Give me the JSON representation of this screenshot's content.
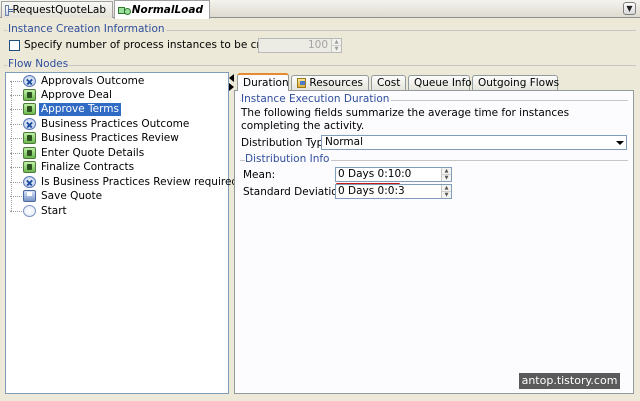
{
  "editor_tabs": [
    {
      "label": "RequestQuoteLab",
      "active": false
    },
    {
      "label": "NormalLoad",
      "active": true
    }
  ],
  "instance_creation": {
    "title": "Instance Creation Information",
    "checkbox_label": "Specify number of process instances to be created",
    "checked": false,
    "count_value": "100"
  },
  "flow_nodes": {
    "title": "Flow Nodes",
    "items": [
      {
        "label": "Approvals Outcome",
        "icon": "decision-icon",
        "selected": false
      },
      {
        "label": "Approve Deal",
        "icon": "activity-icon",
        "selected": false
      },
      {
        "label": "Approve Terms",
        "icon": "activity-icon",
        "selected": true
      },
      {
        "label": "Business Practices Outcome",
        "icon": "decision-icon",
        "selected": false
      },
      {
        "label": "Business Practices Review",
        "icon": "activity-icon",
        "selected": false
      },
      {
        "label": "Enter Quote Details",
        "icon": "activity-icon",
        "selected": false
      },
      {
        "label": "Finalize Contracts",
        "icon": "activity-icon",
        "selected": false
      },
      {
        "label": "Is Business Practices Review required?",
        "icon": "decision-icon",
        "selected": false
      },
      {
        "label": "Save Quote",
        "icon": "save-icon",
        "selected": false
      },
      {
        "label": "Start",
        "icon": "start-icon",
        "selected": false
      }
    ]
  },
  "property_tabs": [
    {
      "label": "Duration",
      "active": true
    },
    {
      "label": "Resources",
      "active": false
    },
    {
      "label": "Cost",
      "active": false
    },
    {
      "label": "Queue Info",
      "active": false
    },
    {
      "label": "Outgoing Flows",
      "active": false
    }
  ],
  "duration": {
    "section_title": "Instance Execution Duration",
    "description": "The following fields summarize the average time for instances completing the activity.",
    "distribution_type_label": "Distribution Type:",
    "distribution_type_value": "Normal",
    "distribution_info_title": "Distribution Info",
    "mean_label": "Mean:",
    "mean_value": "0 Days 0:10:0",
    "std_label": "Standard Deviation:",
    "std_value": "0 Days 0:0:3"
  },
  "watermark": "antop.tistory.com",
  "colors": {
    "section_title": "#2f4e9c",
    "selection": "#316ac5",
    "active_tab_accent": "#e68b2c",
    "annotation_underline": "#c81818"
  }
}
